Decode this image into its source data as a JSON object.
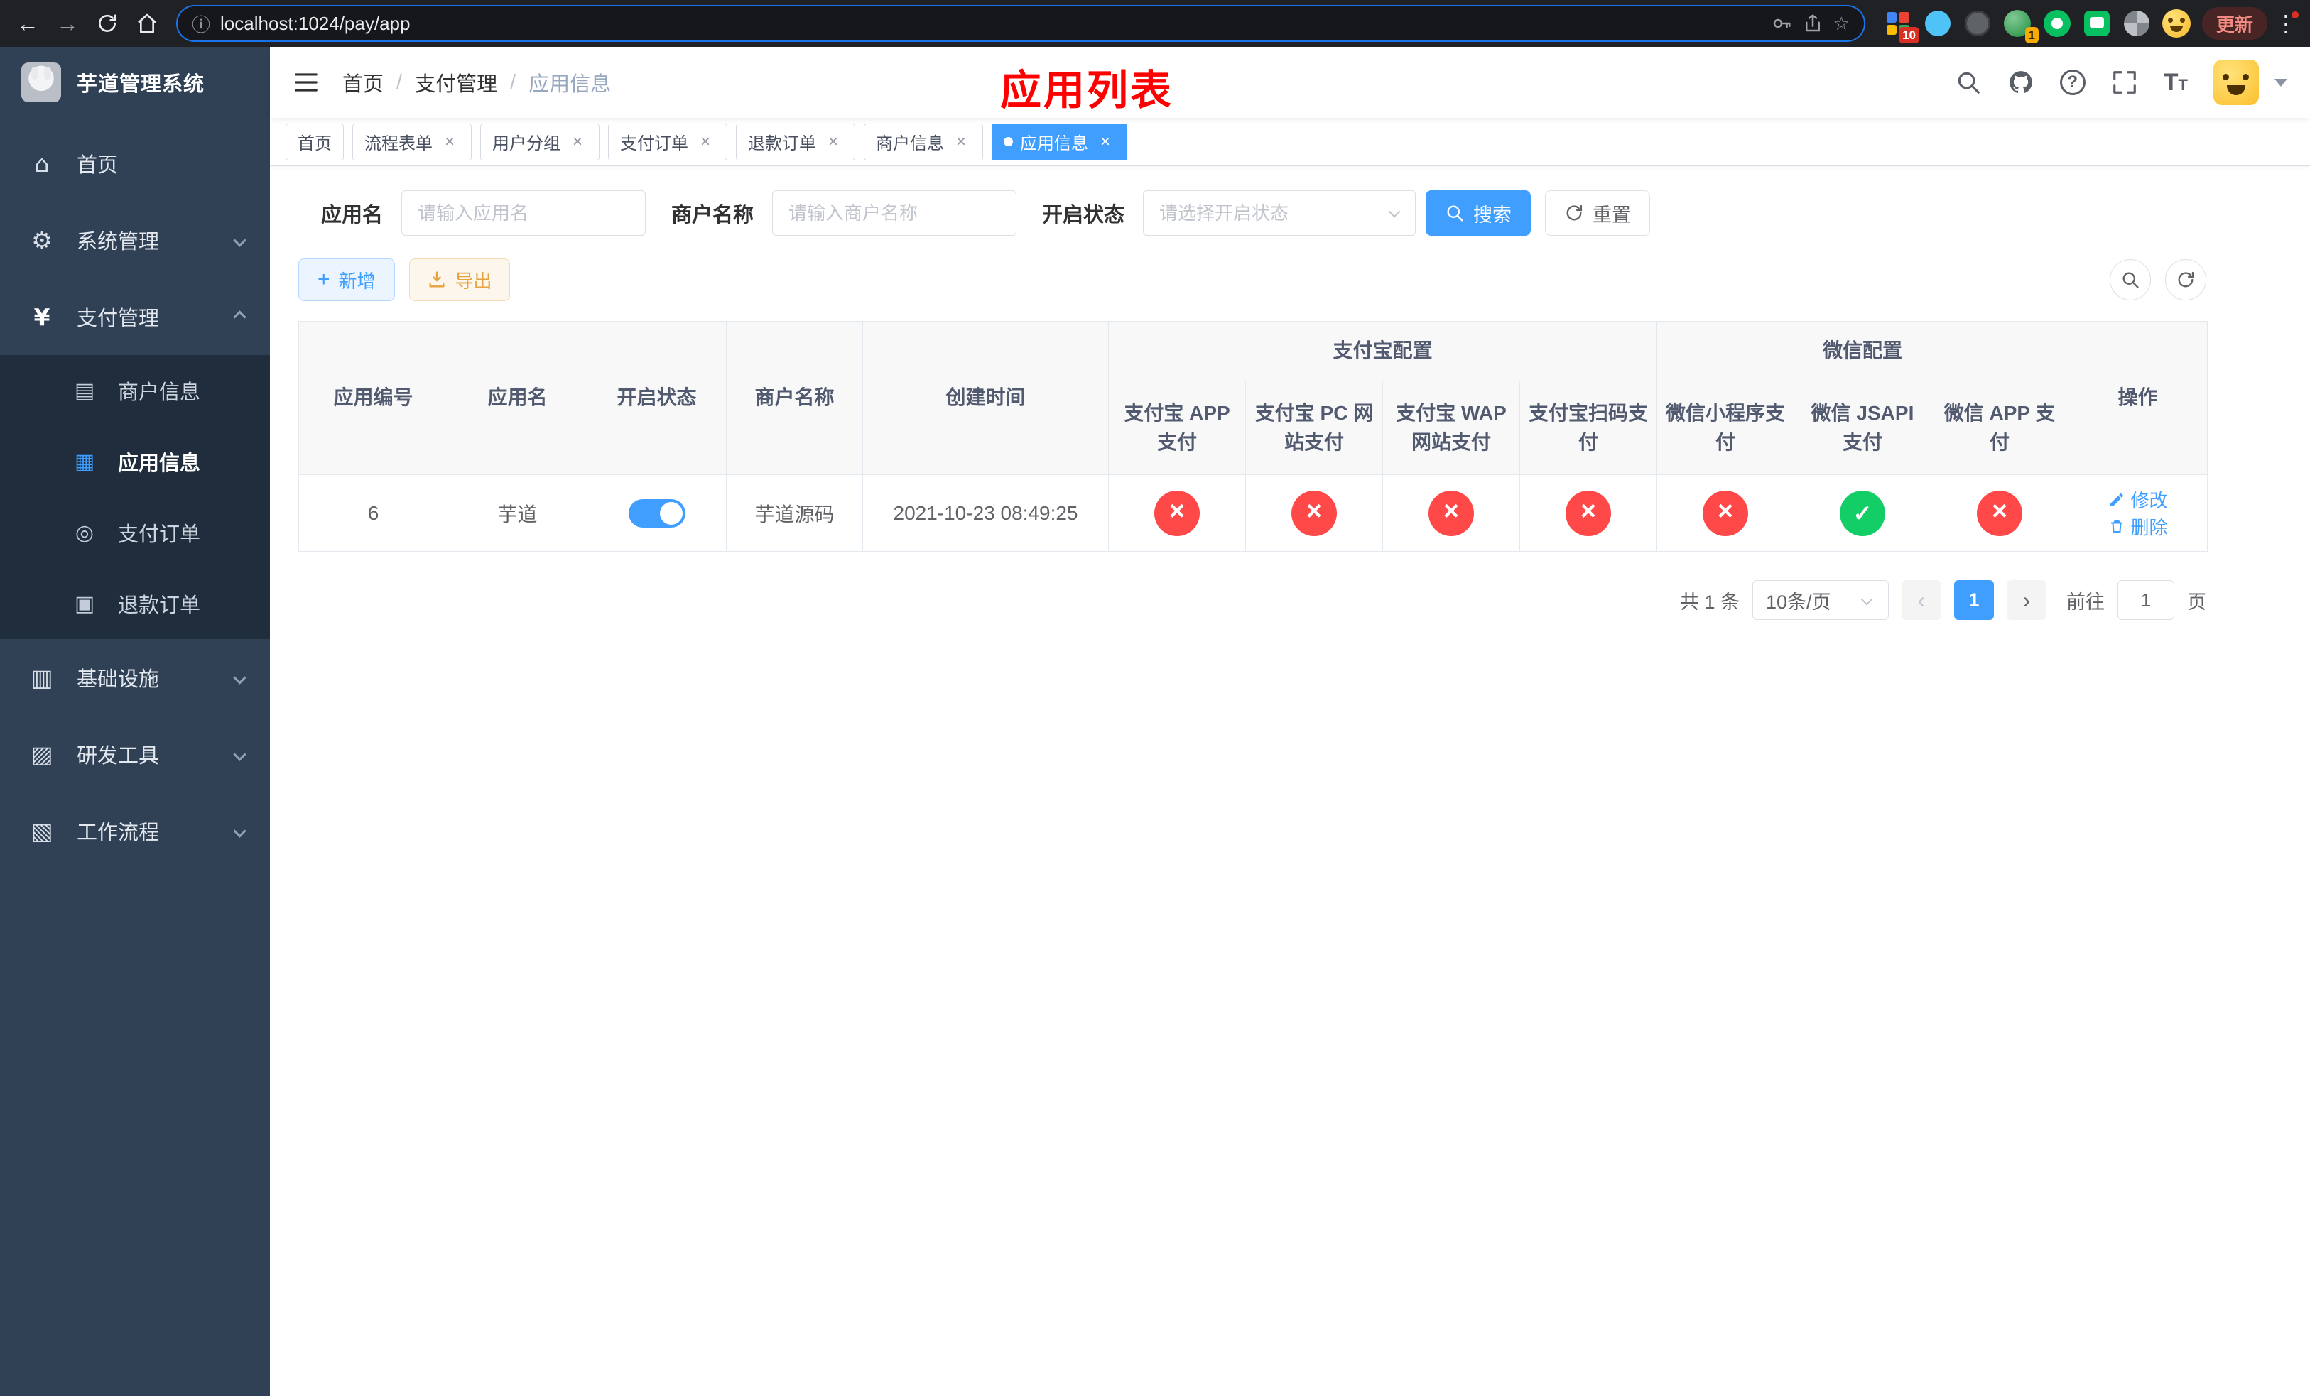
{
  "browser": {
    "url": "localhost:1024/pay/app",
    "update_label": "更新",
    "extension_badge": "10",
    "extension_badge2": "1"
  },
  "icons": {
    "back": "←",
    "forward": "→",
    "info": "ⓘ",
    "star": "☆",
    "dots": "⋮",
    "home": "⌂",
    "system": "⚙",
    "payment": "¥",
    "merchant": "▤",
    "app": "▦",
    "order": "◎",
    "refund": "▣",
    "infra": "▥",
    "devtool": "▨",
    "workflow": "▧",
    "plus": "+",
    "question": "?",
    "prev": "‹",
    "next": "›",
    "fontsize_big": "T",
    "fontsize_small": "T"
  },
  "sidebar": {
    "app_title": "芋道管理系统",
    "items": [
      {
        "label": "首页"
      },
      {
        "label": "系统管理"
      },
      {
        "label": "支付管理"
      },
      {
        "label": "商户信息"
      },
      {
        "label": "应用信息"
      },
      {
        "label": "支付订单"
      },
      {
        "label": "退款订单"
      },
      {
        "label": "基础设施"
      },
      {
        "label": "研发工具"
      },
      {
        "label": "工作流程"
      }
    ]
  },
  "navbar": {
    "breadcrumb": {
      "home": "首页",
      "section": "支付管理",
      "current": "应用信息"
    },
    "annotation": "应用列表"
  },
  "tabs": {
    "items": [
      {
        "label": "首页"
      },
      {
        "label": "流程表单"
      },
      {
        "label": "用户分组"
      },
      {
        "label": "支付订单"
      },
      {
        "label": "退款订单"
      },
      {
        "label": "商户信息"
      },
      {
        "label": "应用信息"
      }
    ],
    "close_glyph": "×"
  },
  "filters": {
    "app_name": {
      "label": "应用名",
      "placeholder": "请输入应用名"
    },
    "merchant_name": {
      "label": "商户名称",
      "placeholder": "请输入商户名称"
    },
    "status": {
      "label": "开启状态",
      "placeholder": "请选择开启状态"
    },
    "search_label": "搜索",
    "reset_label": "重置"
  },
  "toolbar": {
    "add_label": "新增",
    "export_label": "导出"
  },
  "table": {
    "headers": {
      "app_id": "应用编号",
      "app_name": "应用名",
      "status": "开启状态",
      "merchant_name": "商户名称",
      "create_time": "创建时间",
      "alipay_group": "支付宝配置",
      "wechat_group": "微信配置",
      "alipay_app": "支付宝 APP 支付",
      "alipay_pc": "支付宝 PC 网站支付",
      "alipay_wap": "支付宝 WAP 网站支付",
      "alipay_qr": "支付宝扫码支付",
      "wechat_lite": "微信小程序支付",
      "wechat_jsapi": "微信 JSAPI 支付",
      "wechat_app": "微信 APP 支付",
      "actions": "操作"
    },
    "row": {
      "app_id": "6",
      "app_name": "芋道",
      "status_on": true,
      "merchant_name": "芋道源码",
      "create_time": "2021-10-23 08:49:25",
      "configs": {
        "alipay_app": "disabled",
        "alipay_pc": "disabled",
        "alipay_wap": "disabled",
        "alipay_qr": "disabled",
        "wechat_lite": "disabled",
        "wechat_jsapi": "enabled",
        "wechat_app": "disabled"
      },
      "edit_label": "修改",
      "delete_label": "删除"
    }
  },
  "pagination": {
    "total_text": "共 1 条",
    "page_size": "10条/页",
    "current_page": "1",
    "goto_label": "前往",
    "goto_value": "1",
    "goto_suffix": "页"
  },
  "colors": {
    "primary": "#409eff",
    "danger": "#ff4949",
    "success": "#13ce66",
    "warning": "#e6a23c",
    "annotation": "#ff0000",
    "sidebar_bg": "#304156",
    "submenu_bg": "#1f2d3d"
  }
}
